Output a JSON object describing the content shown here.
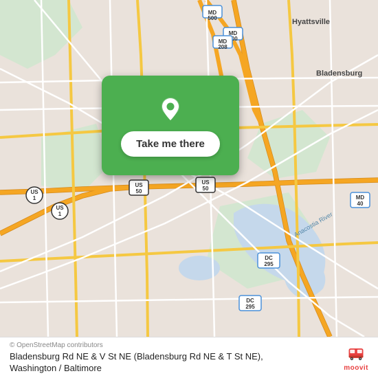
{
  "map": {
    "attribution": "© OpenStreetMap contributors",
    "background_color": "#e8e0d8"
  },
  "card": {
    "button_label": "Take me there"
  },
  "info_bar": {
    "location_name": "Bladensburg Rd NE & V St NE (Bladensburg Rd NE & T St NE), Washington / Baltimore",
    "moovit_label": "moovit"
  }
}
